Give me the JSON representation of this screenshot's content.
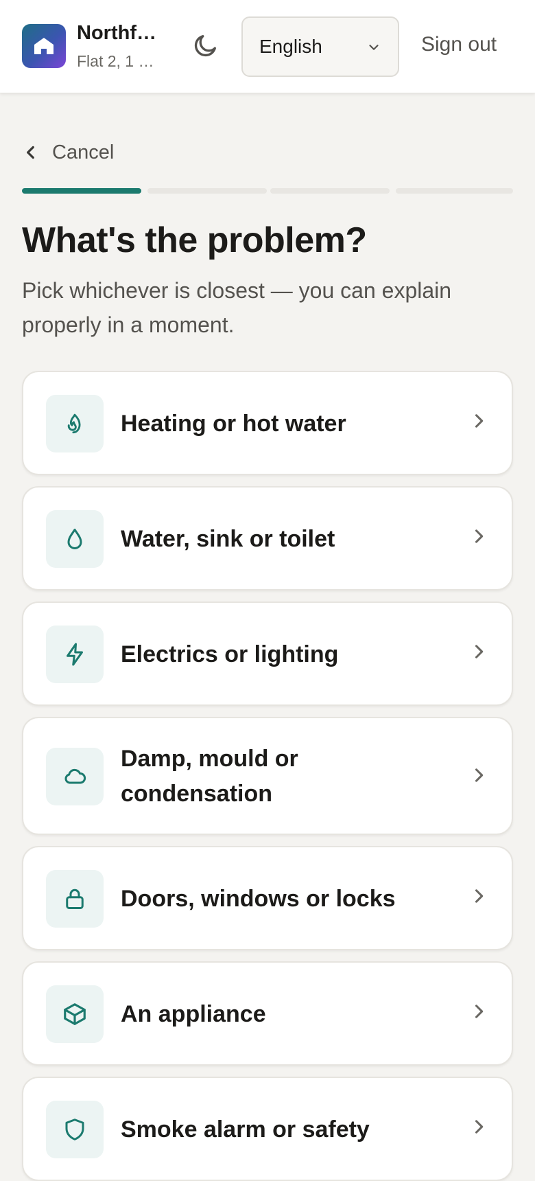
{
  "header": {
    "org_name": "Northf…",
    "org_address": "Flat 2, 1 …",
    "theme_icon": "moon-icon",
    "language": "English",
    "sign_out_label": "Sign out"
  },
  "nav": {
    "cancel_label": "Cancel"
  },
  "progress": {
    "total_steps": 4,
    "current_step": 1
  },
  "page": {
    "title": "What's the problem?",
    "subtitle": "Pick whichever is closest — you can explain properly in a moment."
  },
  "categories": [
    {
      "label": "Heating or hot water",
      "icon": "flame-icon"
    },
    {
      "label": "Water, sink or toilet",
      "icon": "droplet-icon"
    },
    {
      "label": "Electrics or lighting",
      "icon": "lightning-icon"
    },
    {
      "label": "Damp, mould or condensation",
      "icon": "cloud-icon"
    },
    {
      "label": "Doors, windows or locks",
      "icon": "lock-icon"
    },
    {
      "label": "An appliance",
      "icon": "box-icon"
    },
    {
      "label": "Smoke alarm or safety",
      "icon": "shield-icon"
    }
  ],
  "colors": {
    "accent": "#1b7a6e",
    "background": "#f4f3f0",
    "card": "#ffffff",
    "icon_tile": "#ecf4f3"
  }
}
